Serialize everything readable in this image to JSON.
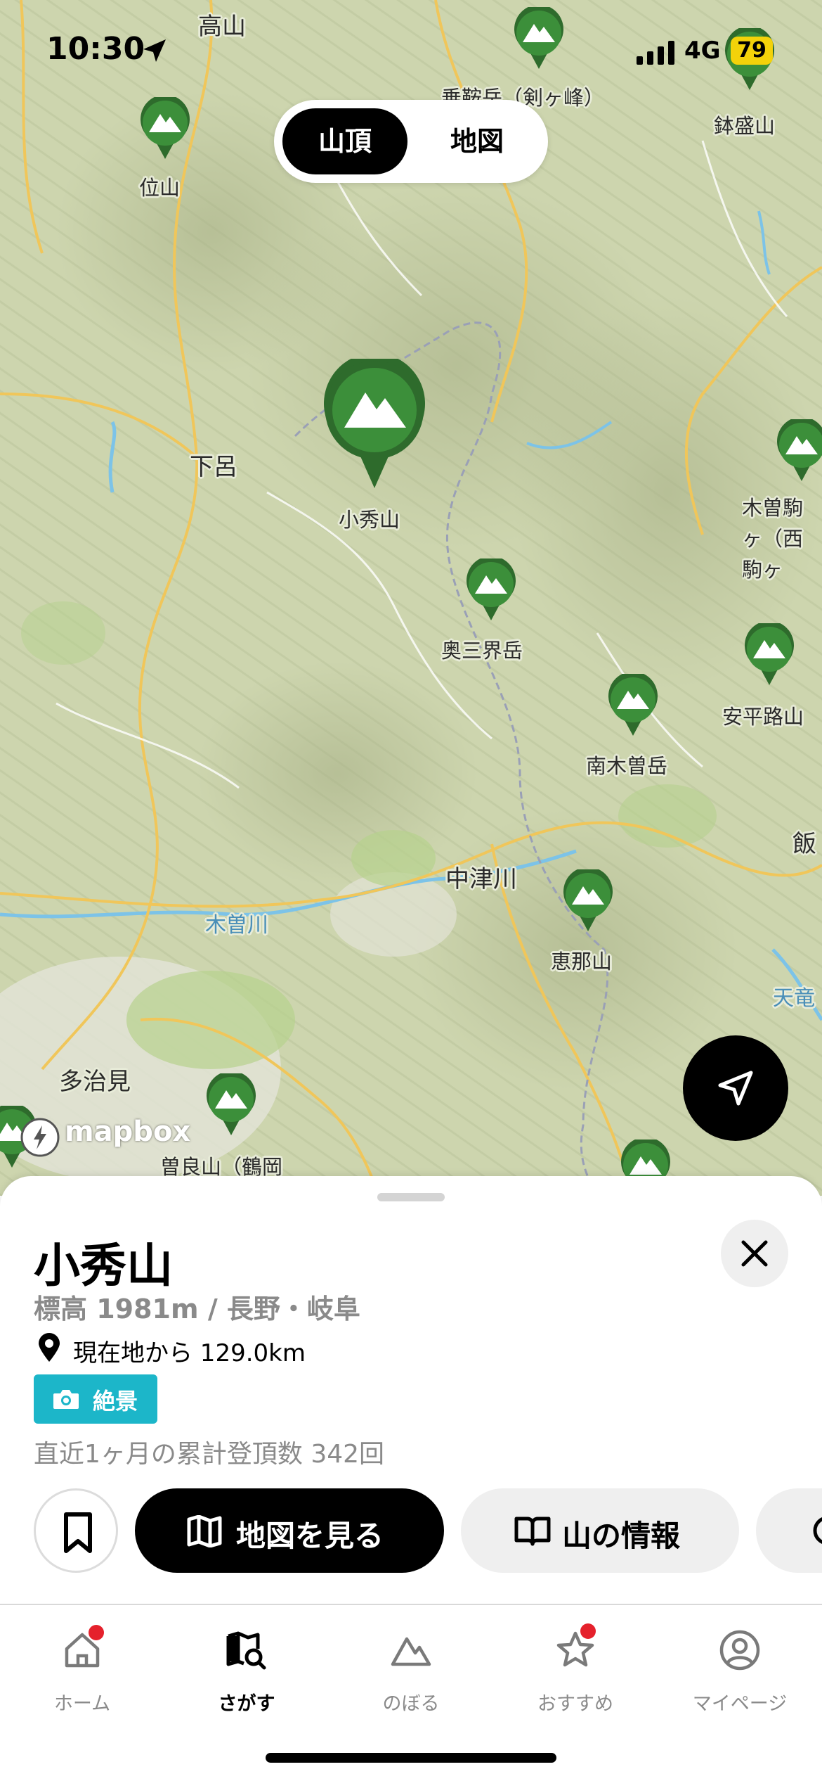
{
  "status_bar": {
    "time": "10:30",
    "network": "4G",
    "battery": "79"
  },
  "view_toggle": {
    "options": [
      "山頂",
      "地図"
    ],
    "selected": "山頂"
  },
  "map": {
    "attribution": "mapbox",
    "place_labels": [
      "高山",
      "下呂",
      "中津川",
      "多治見",
      "木曽川",
      "飯",
      "天竜"
    ],
    "mountains": [
      {
        "name": "位山"
      },
      {
        "name": "乗鞍岳（剣ヶ峰）"
      },
      {
        "name": "鉢盛山"
      },
      {
        "name": "小秀山",
        "selected": true
      },
      {
        "name": "木曽駒ヶ（西駒ヶ"
      },
      {
        "name": "奥三界岳"
      },
      {
        "name": "安平路山"
      },
      {
        "name": "南木曽岳"
      },
      {
        "name": "恵那山"
      },
      {
        "name": "曽良山（鶴岡"
      }
    ],
    "colors": {
      "pin_green": "#3c8f3a",
      "pin_ring": "#2e6b2c",
      "river": "#7cc3e8",
      "road": "#f0c65a"
    }
  },
  "sheet": {
    "title": "小秀山",
    "subtitle": "標高 1981m / 長野・岐阜",
    "distance": "現在地から 129.0km",
    "tag": "絶景",
    "stats": "直近1ヶ月の累計登頂数 342回",
    "buttons": {
      "view_map": "地図を見る",
      "mountain_info": "山の情報"
    },
    "icons": {
      "close": "close-icon",
      "location": "location-pin-icon",
      "camera": "camera-icon",
      "bookmark": "bookmark-icon",
      "map": "map-icon",
      "book": "book-icon"
    }
  },
  "tab_bar": {
    "items": [
      {
        "label": "ホーム",
        "icon": "home-icon",
        "badge": true
      },
      {
        "label": "さがす",
        "icon": "map-search-icon",
        "active": true
      },
      {
        "label": "のぼる",
        "icon": "mountain-icon"
      },
      {
        "label": "おすすめ",
        "icon": "star-icon",
        "badge": true
      },
      {
        "label": "マイページ",
        "icon": "profile-icon"
      }
    ]
  },
  "accent_colors": {
    "tag": "#1cb6c9",
    "badge": "#e5212c",
    "battery": "#f3d20a"
  }
}
